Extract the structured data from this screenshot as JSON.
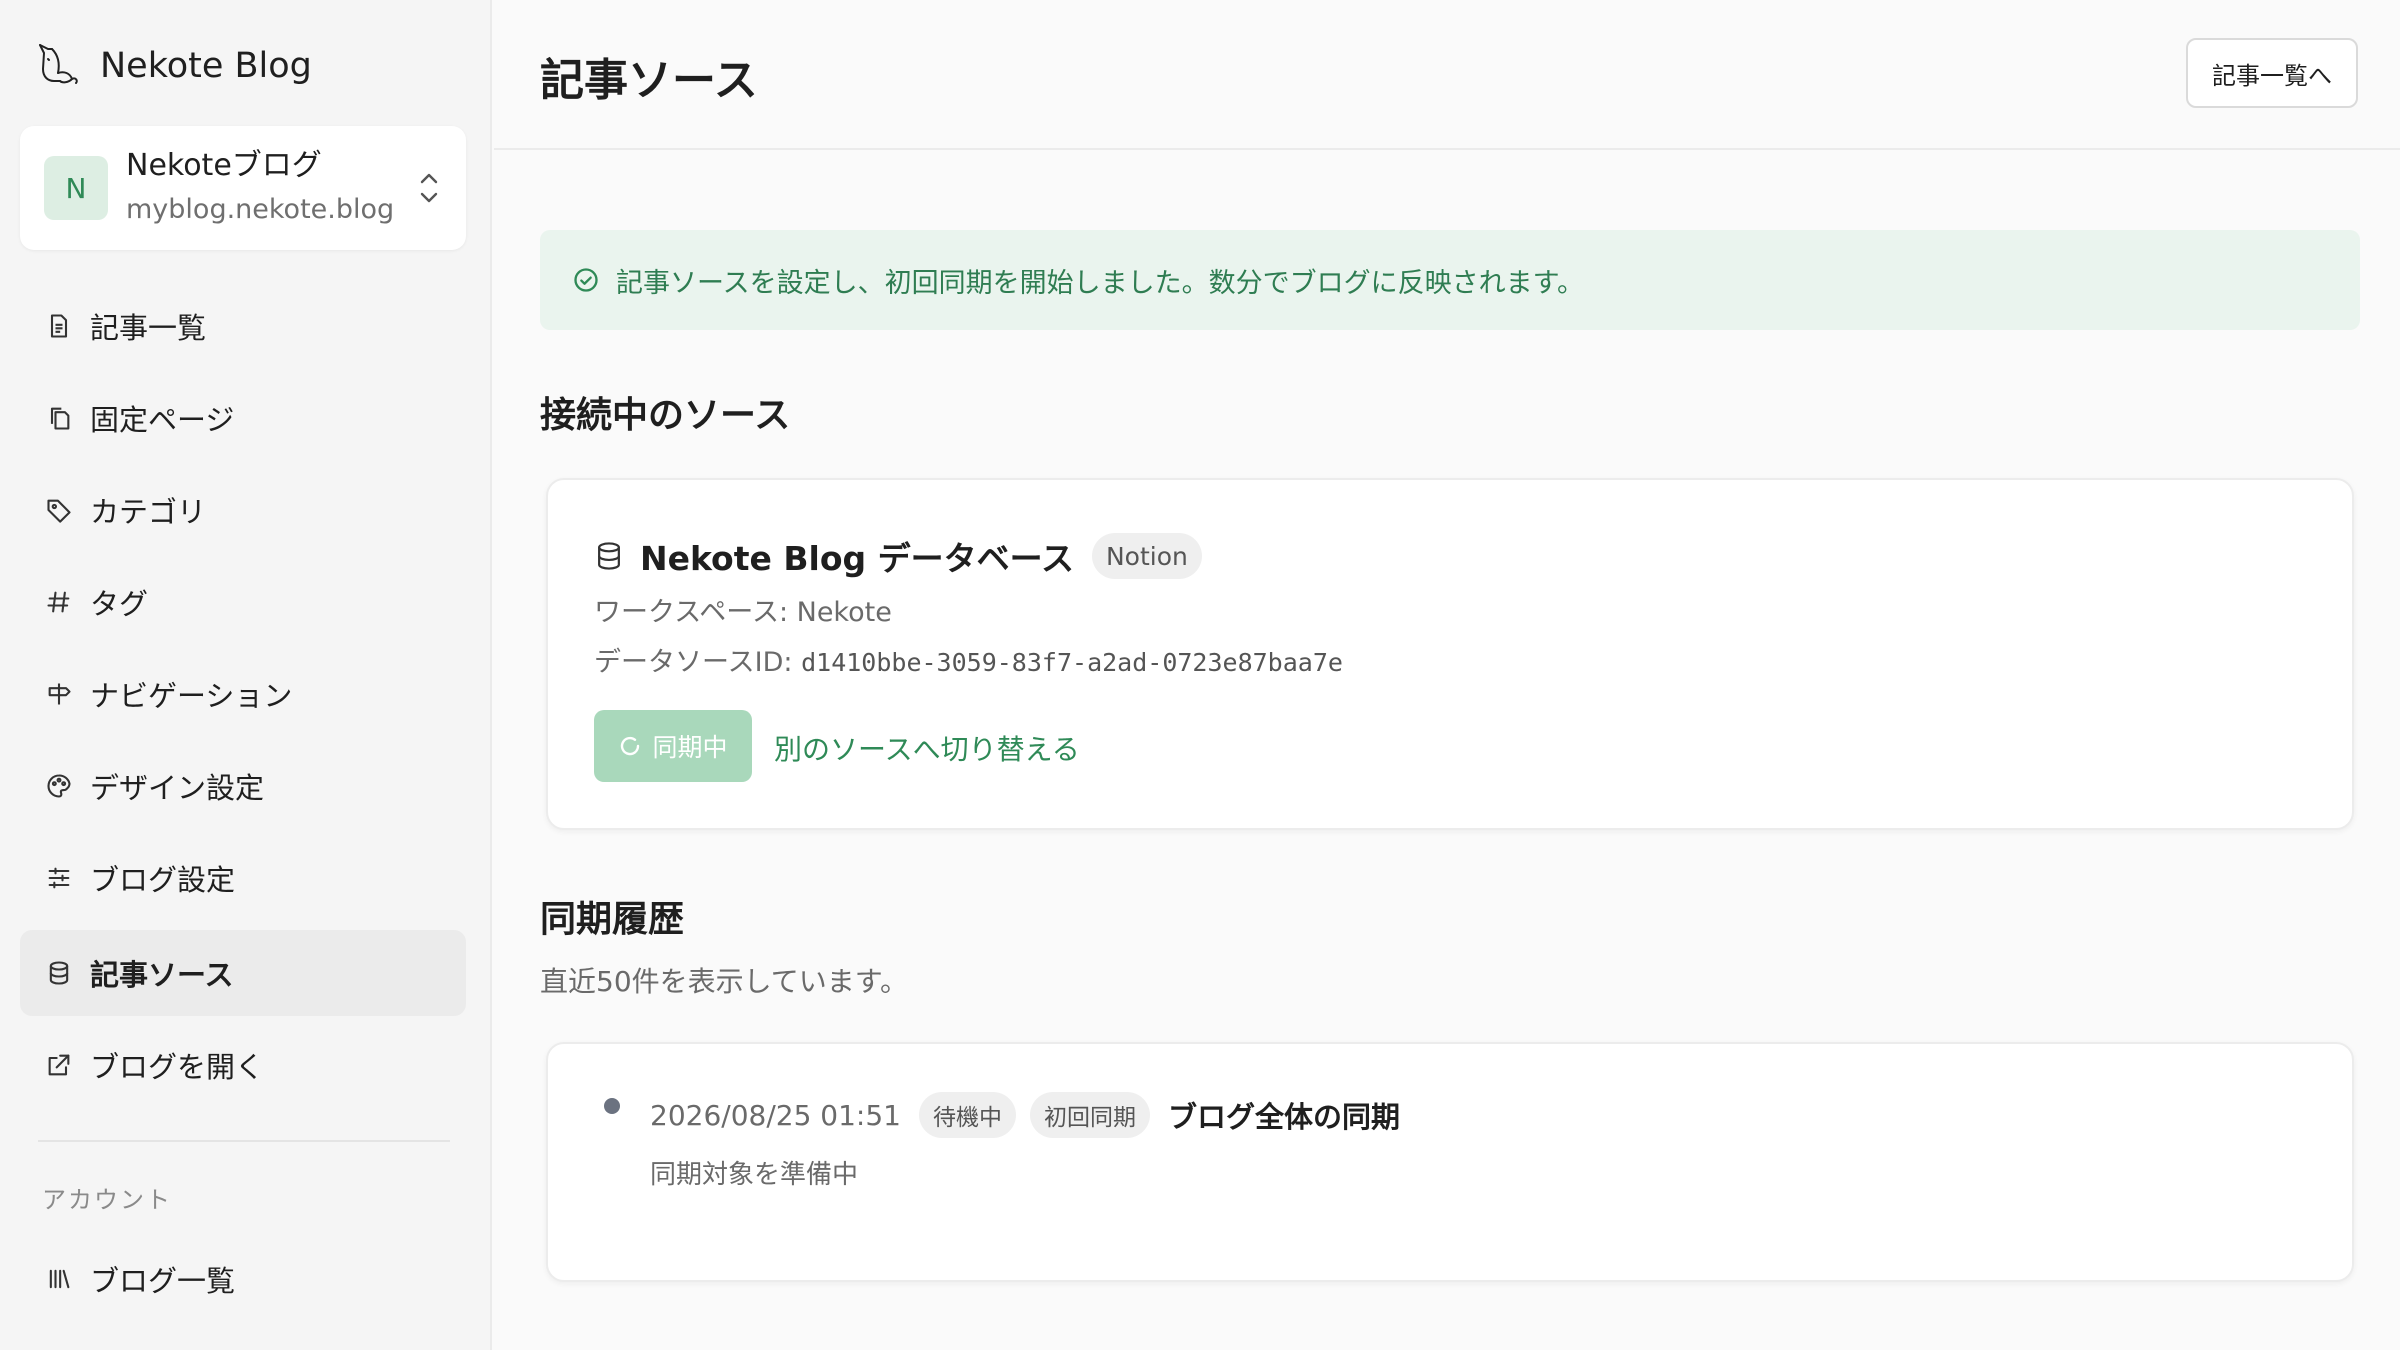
{
  "brand": {
    "name": "Nekote Blog",
    "icon": "cat-logo-icon"
  },
  "blog_switcher": {
    "avatar": "N",
    "name": "Nekoteブログ",
    "domain": "myblog.nekote.blog"
  },
  "nav": {
    "items": [
      {
        "label": "記事一覧",
        "icon": "document-icon"
      },
      {
        "label": "固定ページ",
        "icon": "pages-icon"
      },
      {
        "label": "カテゴリ",
        "icon": "tag-icon"
      },
      {
        "label": "タグ",
        "icon": "hash-icon"
      },
      {
        "label": "ナビゲーション",
        "icon": "signpost-icon"
      },
      {
        "label": "デザイン設定",
        "icon": "palette-icon"
      },
      {
        "label": "ブログ設定",
        "icon": "sliders-icon"
      },
      {
        "label": "記事ソース",
        "icon": "database-icon",
        "active": true
      },
      {
        "label": "ブログを開く",
        "icon": "external-link-icon"
      }
    ],
    "section_account": "アカウント",
    "account_items": [
      {
        "label": "ブログ一覧",
        "icon": "library-icon"
      }
    ]
  },
  "header": {
    "title": "記事ソース",
    "back_button": "記事一覧へ"
  },
  "alert": {
    "text": "記事ソースを設定し、初回同期を開始しました。数分でブログに反映されます。",
    "color": "#2f7d52"
  },
  "connected": {
    "heading": "接続中のソース",
    "source_name": "Nekote Blog データベース",
    "provider": "Notion",
    "workspace": "ワークスペース: Nekote",
    "datasource_label": "データソースID: ",
    "datasource_id": "d1410bbe-3059-83f7-a2ad-0723e87baa7e",
    "sync_button": "同期中",
    "switch_link": "別のソースへ切り替える"
  },
  "history": {
    "heading": "同期履歴",
    "subtitle": "直近50件を表示しています。",
    "entries": [
      {
        "time": "2026/08/25 01:51",
        "status": "待機中",
        "kind": "初回同期",
        "title": "ブログ全体の同期",
        "detail": "同期対象を準備中"
      }
    ]
  },
  "colors": {
    "accent": "#2f8a57",
    "alert_bg": "#eaf4ee",
    "sync_button_bg": "#a9d8bb"
  }
}
